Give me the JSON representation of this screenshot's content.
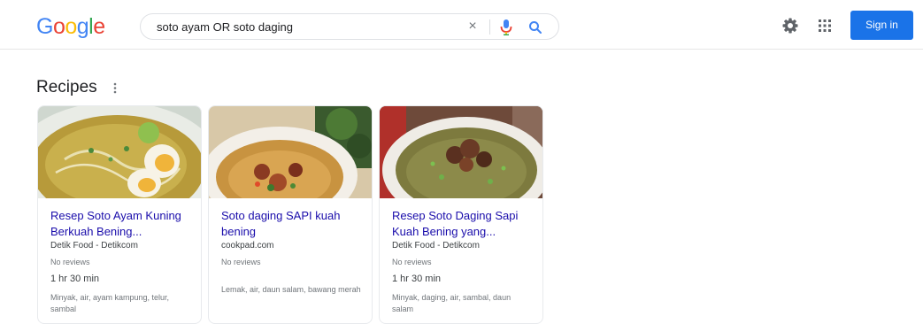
{
  "header": {
    "logo_letters": [
      {
        "char": "G",
        "color": "#4285F4"
      },
      {
        "char": "o",
        "color": "#EA4335"
      },
      {
        "char": "o",
        "color": "#FBBC05"
      },
      {
        "char": "g",
        "color": "#4285F4"
      },
      {
        "char": "l",
        "color": "#34A853"
      },
      {
        "char": "e",
        "color": "#EA4335"
      }
    ],
    "search_query": "soto ayam OR soto daging",
    "clear_icon": "×",
    "sign_in_label": "Sign in",
    "icons": [
      "clear-icon",
      "mic-icon",
      "search-icon",
      "settings-icon",
      "apps-icon"
    ]
  },
  "section": {
    "title": "Recipes",
    "more_icon": "vertical-dots-icon"
  },
  "cards": [
    {
      "title": "Resep Soto Ayam Kuning Berkuah Bening...",
      "source": "Detik Food - Detikcom",
      "reviews": "No reviews",
      "time": "1 hr 30 min",
      "ingredients": "Minyak, air, ayam kampung, telur, sambal"
    },
    {
      "title": "Soto daging SAPI kuah bening",
      "source": "cookpad.com",
      "reviews": "No reviews",
      "time": "",
      "ingredients": "Lemak, air, daun salam, bawang merah"
    },
    {
      "title": "Resep Soto Daging Sapi Kuah Bening yang...",
      "source": "Detik Food - Detikcom",
      "reviews": "No reviews",
      "time": "1 hr 30 min",
      "ingredients": "Minyak, daging, air, sambal, daun salam"
    }
  ],
  "colors": {
    "link": "#1a0dab",
    "sign_in": "#1a73e8",
    "google_blue": "#4285F4",
    "google_red": "#EA4335",
    "google_yellow": "#FBBC05",
    "google_green": "#34A853"
  }
}
